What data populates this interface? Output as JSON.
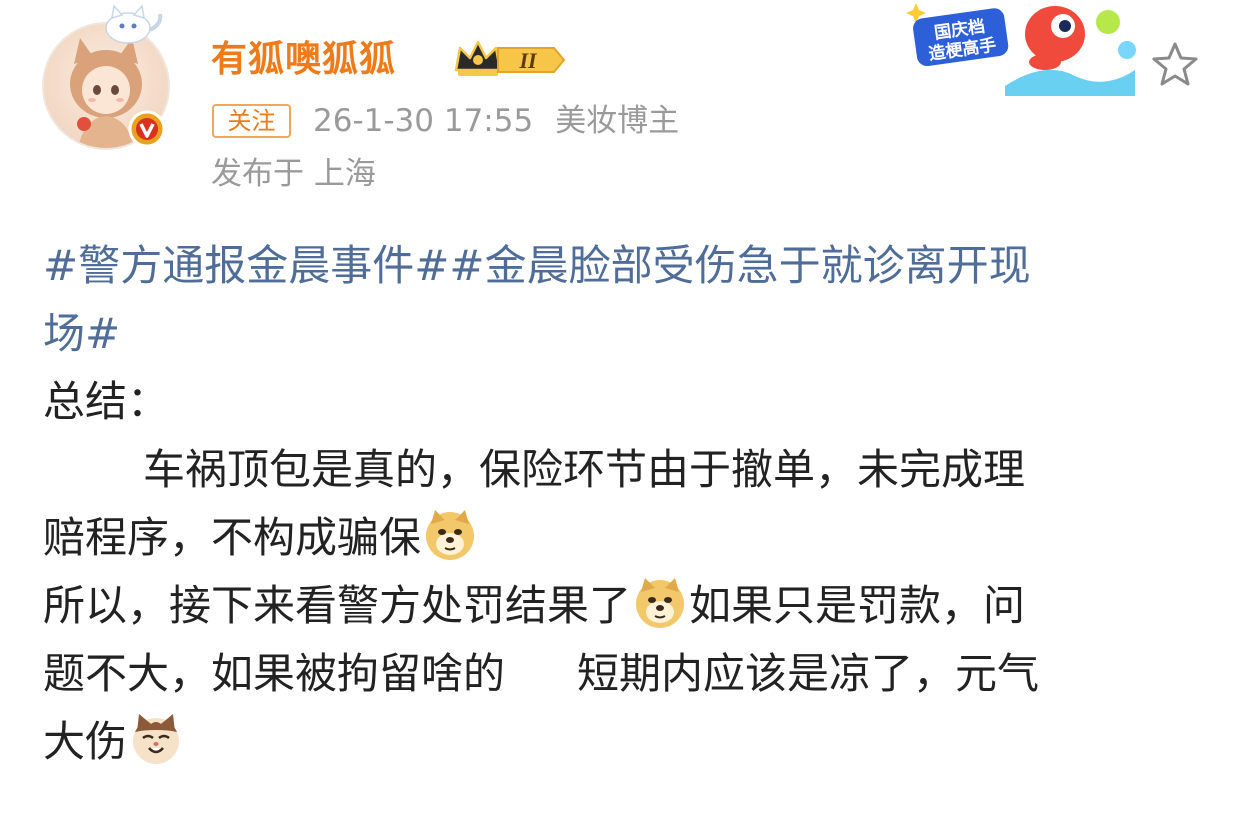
{
  "post": {
    "author": {
      "name": "有狐噢狐狐",
      "vip_level": "II",
      "verified": true
    },
    "follow_label": "关注",
    "timestamp": "26-1-30 17:55",
    "author_tag": "美妆博主",
    "location": "发布于 上海",
    "promo_text": {
      "line1": "国庆档",
      "line2": "造梗高手"
    },
    "content": {
      "hashtag_line1": "#警方通报金晨事件##金晨脸部受伤急于就诊离开现",
      "hashtag_line2": "场#",
      "summary_label": "总结：",
      "para1_line1": "车祸顶包是真的，保险环节由于撤单，未完成理",
      "para1_line2": "赔程序，不构成骗保",
      "para2_line1_a": "所以，接下来看警方处罚结果了",
      "para2_line1_b": "如果只是罚款，问",
      "para2_line2_a": "题不大，如果被拘留啥的",
      "para2_line2_b": "短期内应该是凉了，元气",
      "para2_line3": "大伤"
    }
  },
  "icons": {
    "avatar": "anime-fox-girl-avatar",
    "verify": "verified-v-badge",
    "vip": "crown-vip-badge",
    "promo": "national-day-promo-banner",
    "favorite": "star-outline-icon",
    "emoji_doge": "doge-emoji",
    "emoji_cat": "cat-emoji"
  },
  "colors": {
    "username": "#ee7a1a",
    "hashtag": "#4f6d98",
    "meta": "#9a9a9a",
    "text": "#222222",
    "verify_badge": "#e8a21b"
  }
}
